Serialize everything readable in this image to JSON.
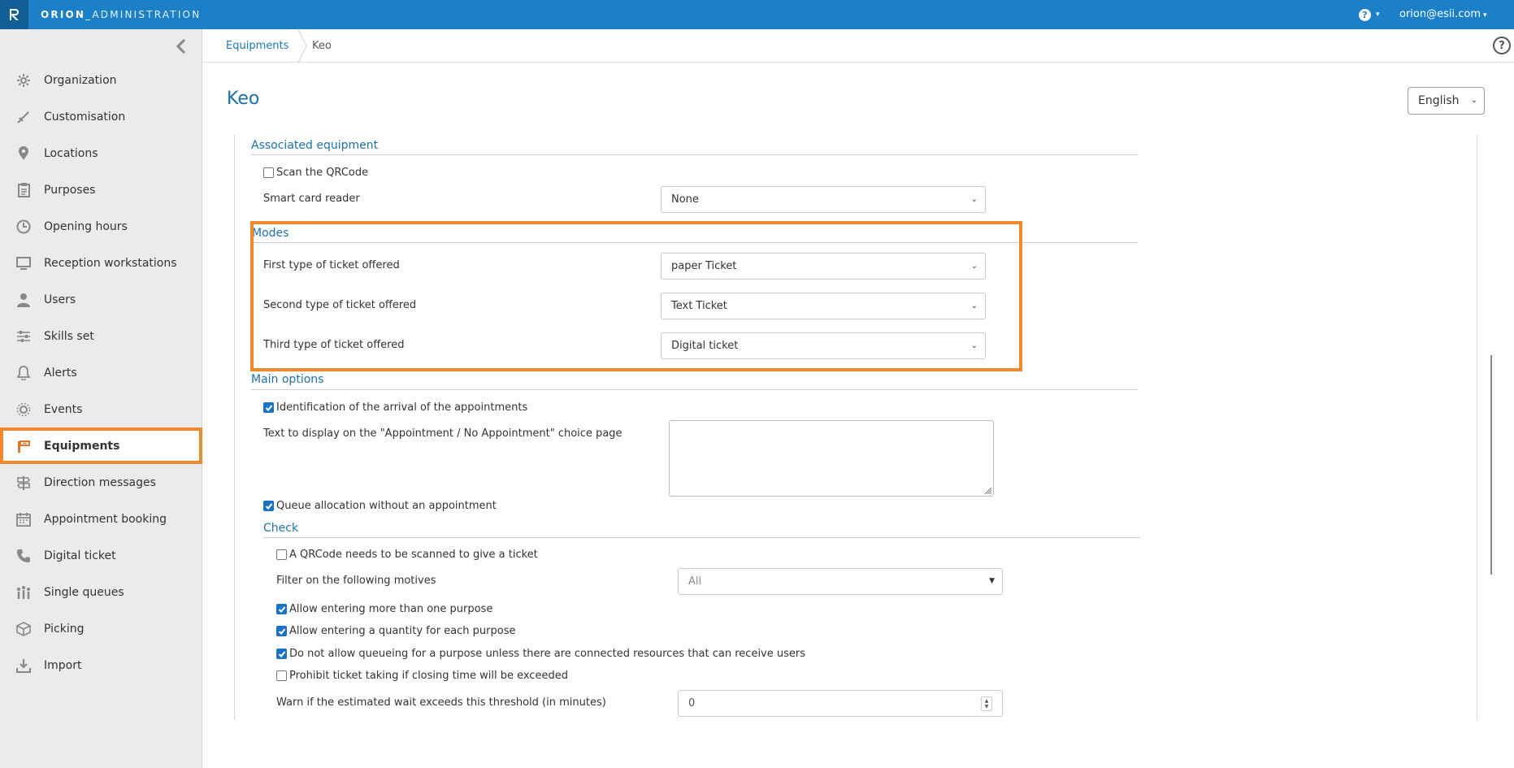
{
  "topbar": {
    "brand_bold": "ORION",
    "brand_rest": "_ADMINISTRATION",
    "user": "orion@esii.com"
  },
  "sidebar": {
    "items": [
      {
        "label": "Organization",
        "icon": "gear-icon"
      },
      {
        "label": "Customisation",
        "icon": "brush-icon"
      },
      {
        "label": "Locations",
        "icon": "map-pin-icon"
      },
      {
        "label": "Purposes",
        "icon": "clipboard-icon"
      },
      {
        "label": "Opening hours",
        "icon": "clock-icon"
      },
      {
        "label": "Reception workstations",
        "icon": "monitor-icon"
      },
      {
        "label": "Users",
        "icon": "user-icon"
      },
      {
        "label": "Skills set",
        "icon": "sliders-icon"
      },
      {
        "label": "Alerts",
        "icon": "bell-icon"
      },
      {
        "label": "Events",
        "icon": "cog-event-icon"
      },
      {
        "label": "Equipments",
        "icon": "kiosk-icon",
        "active": true
      },
      {
        "label": "Direction messages",
        "icon": "signpost-icon"
      },
      {
        "label": "Appointment booking",
        "icon": "calendar-icon"
      },
      {
        "label": "Digital ticket",
        "icon": "phone-icon"
      },
      {
        "label": "Single queues",
        "icon": "queue-icon"
      },
      {
        "label": "Picking",
        "icon": "box-icon"
      },
      {
        "label": "Import",
        "icon": "download-icon"
      }
    ]
  },
  "breadcrumb": {
    "parent": "Equipments",
    "current": "Keo"
  },
  "page": {
    "title": "Keo",
    "language": "English"
  },
  "associated_equipment": {
    "title": "Associated equipment",
    "scan_qrcode_label": "Scan the QRCode",
    "smart_card_label": "Smart card reader",
    "smart_card_value": "None"
  },
  "modes": {
    "title": "Modes",
    "first_label": "First type of ticket offered",
    "first_value": "paper Ticket",
    "second_label": "Second type of ticket offered",
    "second_value": "Text Ticket",
    "third_label": "Third type of ticket offered",
    "third_value": "Digital ticket"
  },
  "main_options": {
    "title": "Main options",
    "identification_label": "Identification of the arrival of the appointments",
    "text_display_label": "Text to display on the \"Appointment / No Appointment\" choice page",
    "text_display_value": "",
    "queue_alloc_label": "Queue allocation without an appointment"
  },
  "check": {
    "title": "Check",
    "qrcode_label": "A QRCode needs to be scanned to give a ticket",
    "filter_label": "Filter on the following motives",
    "filter_value": "All",
    "more_purpose_label": "Allow entering more than one purpose",
    "quantity_label": "Allow entering a quantity for each purpose",
    "no_queue_label": "Do not allow queueing for a purpose unless there are connected resources that can receive users",
    "prohibit_label": "Prohibit ticket taking if closing time will be exceeded",
    "warn_label": "Warn if the estimated wait exceeds this threshold (in minutes)",
    "warn_value": "0"
  },
  "checkbox_states": {
    "scan_qrcode": false,
    "identification": true,
    "queue_alloc": true,
    "check_qrcode": false,
    "more_purpose": true,
    "quantity": true,
    "no_queue": true,
    "prohibit": false
  },
  "colors": {
    "topbar": "#1b80c8",
    "accent": "#1f72a8",
    "highlight": "#f08a2c"
  }
}
